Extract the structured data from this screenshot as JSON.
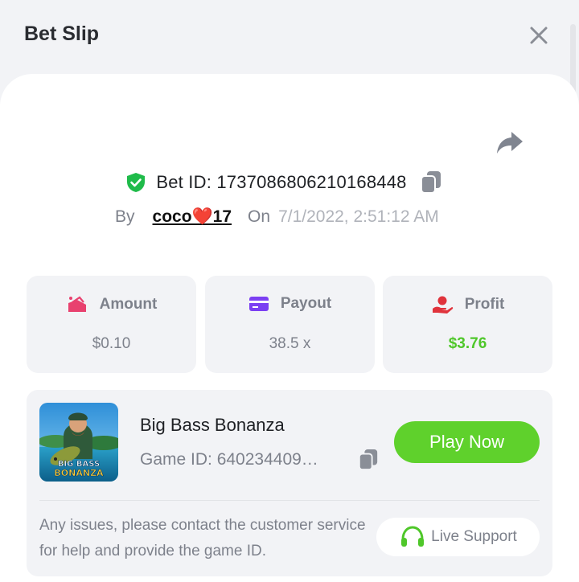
{
  "header": {
    "title": "Bet Slip"
  },
  "bet": {
    "id_label": "Bet ID: 1737086806210168448",
    "by_label": "By",
    "username": "coco❤️17",
    "on_label": "On",
    "datetime": "7/1/2022, 2:51:12 AM"
  },
  "stats": {
    "amount": {
      "label": "Amount",
      "value": "$0.10"
    },
    "payout": {
      "label": "Payout",
      "value": "38.5 x"
    },
    "profit": {
      "label": "Profit",
      "value": "$3.76"
    }
  },
  "game": {
    "name": "Big Bass Bonanza",
    "game_id": "Game ID: 640234409…",
    "thumbnail_text": [
      "BIG BASS",
      "BONANZA"
    ],
    "play_label": "Play Now",
    "issue_text": "Any issues, please contact the customer service for help and provide the game ID.",
    "support_label": "Live Support"
  },
  "icons": {
    "close": "close-icon",
    "share": "share-icon",
    "shield": "shield-check-icon",
    "copy": "copy-icon",
    "amount": "money-icon",
    "payout": "card-icon",
    "profit": "hand-coin-icon",
    "support": "headset-icon"
  },
  "colors": {
    "accent_green": "#5fd12c",
    "profit_green": "#4fc72a",
    "shield_green": "#1fbb4a",
    "amount_pink": "#e8416f",
    "payout_purple": "#7b3ff2",
    "profit_red": "#e0333c"
  }
}
